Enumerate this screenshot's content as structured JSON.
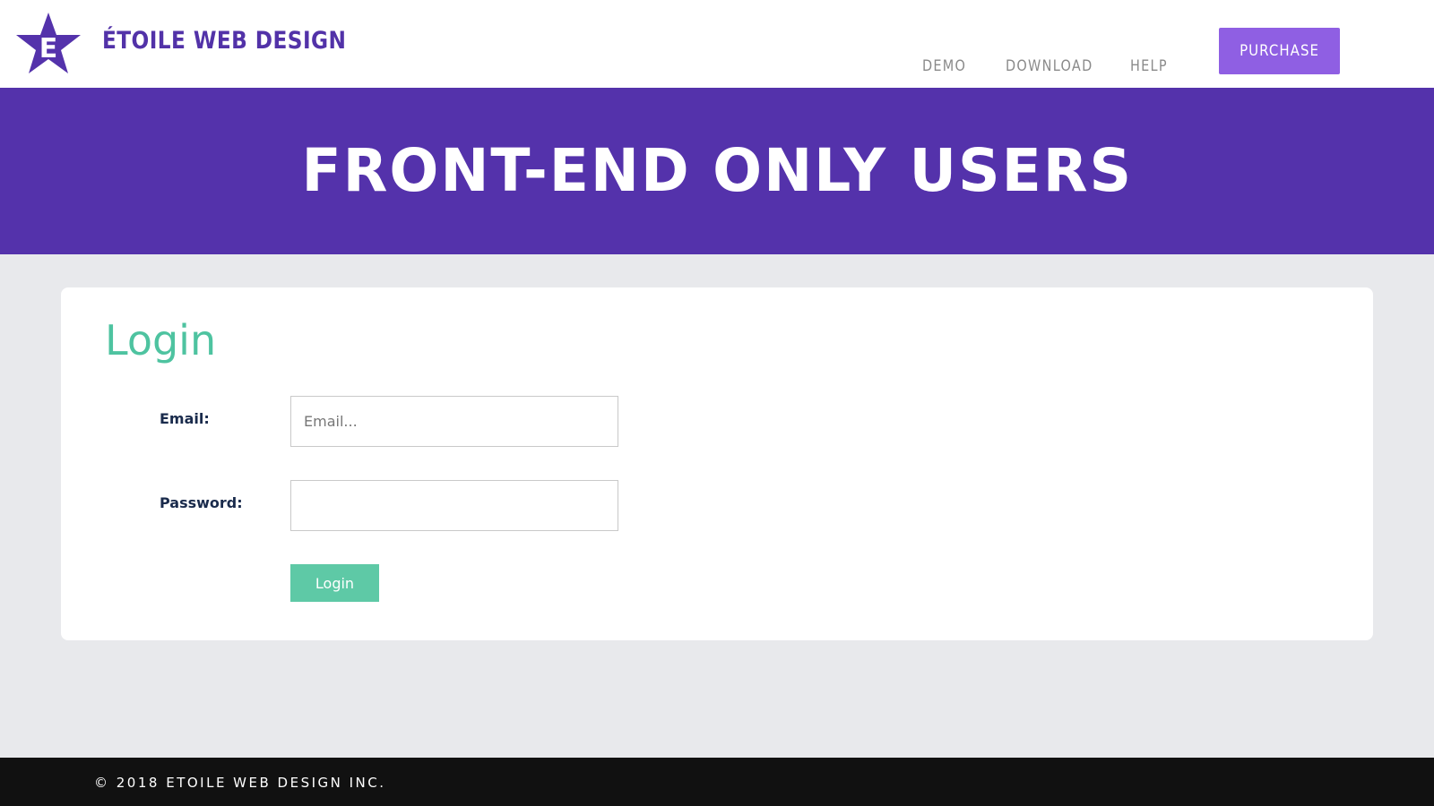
{
  "header": {
    "brand": "ÉTOILE WEB DESIGN",
    "logo_letter": "E",
    "nav": [
      "DEMO",
      "DOWNLOAD",
      "HELP"
    ],
    "purchase_label": "PURCHASE"
  },
  "banner": {
    "title": "FRONT-END ONLY USERS"
  },
  "login": {
    "title": "Login",
    "email_label": "Email:",
    "email_placeholder": "Email...",
    "email_value": "",
    "password_label": "Password:",
    "password_value": "",
    "button_label": "Login"
  },
  "footer": {
    "copyright": "© 2018 ETOILE WEB DESIGN INC."
  },
  "colors": {
    "brand_purple": "#5432ab",
    "purchase_purple": "#8f5fe3",
    "accent_green": "#5ec9a6",
    "page_bg": "#e8e9ec",
    "footer_bg": "#111111"
  }
}
